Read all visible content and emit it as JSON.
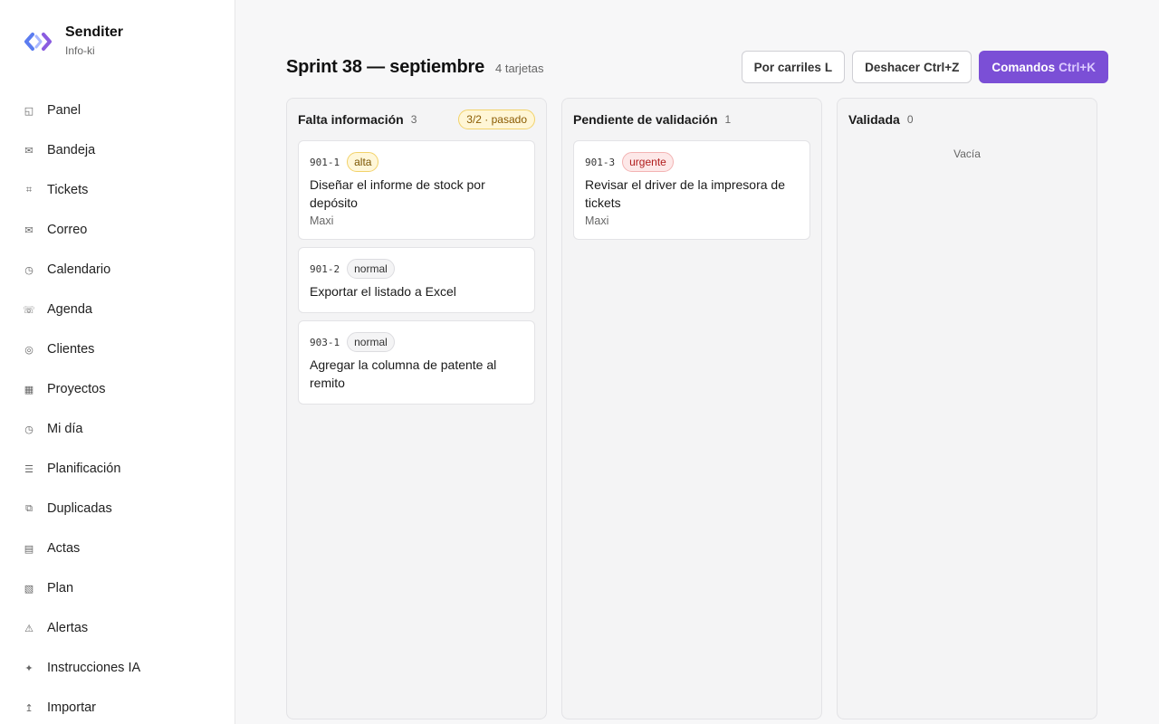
{
  "brand": {
    "name": "Senditer",
    "subtitle": "Info-ki",
    "logo_icon": "diamond-chevrons-logo",
    "accent": "#7b4fd6"
  },
  "nav": [
    {
      "label": "Panel",
      "icon": "layout-icon",
      "glyph": "◱"
    },
    {
      "label": "Bandeja",
      "icon": "envelope-icon",
      "glyph": "✉"
    },
    {
      "label": "Tickets",
      "icon": "hash-frame-icon",
      "glyph": "⌗"
    },
    {
      "label": "Correo",
      "icon": "mail-icon",
      "glyph": "✉"
    },
    {
      "label": "Calendario",
      "icon": "clock-icon",
      "glyph": "◷"
    },
    {
      "label": "Agenda",
      "icon": "phone-icon",
      "glyph": "☏"
    },
    {
      "label": "Clientes",
      "icon": "target-icon",
      "glyph": "◎"
    },
    {
      "label": "Proyectos",
      "icon": "grid-icon",
      "glyph": "▦"
    },
    {
      "label": "Mi día",
      "icon": "clock-icon",
      "glyph": "◷"
    },
    {
      "label": "Planificación",
      "icon": "list-icon",
      "glyph": "☰"
    },
    {
      "label": "Duplicadas",
      "icon": "copy-icon",
      "glyph": "⧉"
    },
    {
      "label": "Actas",
      "icon": "document-icon",
      "glyph": "▤"
    },
    {
      "label": "Plan",
      "icon": "hatched-square-icon",
      "glyph": "▧"
    },
    {
      "label": "Alertas",
      "icon": "warning-icon",
      "glyph": "⚠"
    },
    {
      "label": "Instrucciones IA",
      "icon": "sparkle-icon",
      "glyph": "✦"
    },
    {
      "label": "Importar",
      "icon": "upload-icon",
      "glyph": "↥"
    }
  ],
  "header": {
    "title": "Sprint 38 — septiembre",
    "card_count": "4 tarjetas"
  },
  "toolbar": {
    "lanes_label": "Por carriles",
    "lanes_kbd": "L",
    "undo_label": "Deshacer",
    "undo_kbd": "Ctrl+Z",
    "commands_label": "Comandos",
    "commands_kbd": "Ctrl+K"
  },
  "columns": [
    {
      "title": "Falta información",
      "count": "3",
      "wip": "3/2 · pasado",
      "cards": [
        {
          "id": "901-1",
          "priority": "alta",
          "title": "Diseñar el informe de stock por depósito",
          "assignee": "Maxi"
        },
        {
          "id": "901-2",
          "priority": "normal",
          "title": "Exportar el listado a Excel",
          "assignee": ""
        },
        {
          "id": "903-1",
          "priority": "normal",
          "title": "Agregar la columna de patente al remito",
          "assignee": ""
        }
      ]
    },
    {
      "title": "Pendiente de validación",
      "count": "1",
      "wip": "",
      "cards": [
        {
          "id": "901-3",
          "priority": "urgente",
          "title": "Revisar el driver de la impresora de tickets",
          "assignee": "Maxi"
        }
      ]
    },
    {
      "title": "Validada",
      "count": "0",
      "wip": "",
      "empty_text": "Vacía",
      "cards": []
    }
  ]
}
